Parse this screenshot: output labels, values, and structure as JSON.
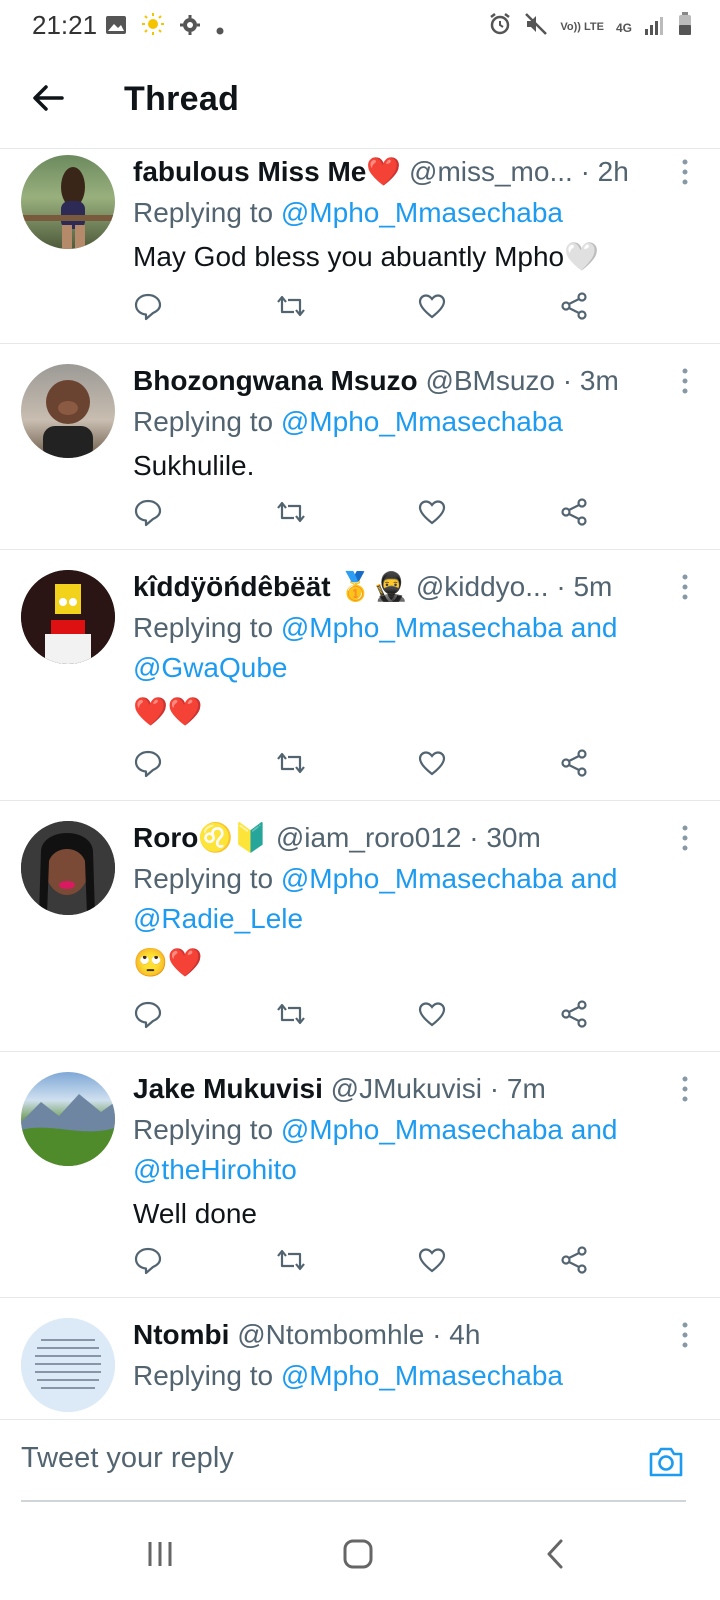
{
  "status_bar": {
    "time": "21:21",
    "left_icons": [
      "image-icon",
      "sun-icon",
      "settings-gear-icon",
      "dot-icon"
    ],
    "right_icons": [
      "alarm-icon",
      "mute-icon",
      "volte-icon",
      "4g-icon",
      "signal-icon",
      "battery-icon"
    ],
    "volte_text": "Vo)) LTE",
    "network_text": "4G"
  },
  "app_bar": {
    "title": "Thread"
  },
  "tweets": [
    {
      "name": "fabulous Miss Me❤️",
      "handle": "@miss_mo...",
      "time": "· 2h",
      "replying_prefix": "Replying to ",
      "replying_to": "@Mpho_Mmasechaba",
      "text": "May God bless you abuantly Mpho🤍"
    },
    {
      "name": "Bhozongwana Msuzo",
      "handle": "@BMsuzo",
      "time": "· 3m",
      "replying_prefix": "Replying to ",
      "replying_to": "@Mpho_Mmasechaba",
      "text": "Sukhulile."
    },
    {
      "name": "kîddÿöńdêbëät 🥇🥷",
      "handle": "@kiddyo...",
      "time": "· 5m",
      "replying_prefix": "Replying to ",
      "replying_to": "@Mpho_Mmasechaba and @GwaQube",
      "text": "❤️❤️"
    },
    {
      "name": "Roro♌🔰",
      "handle": "@iam_roro012",
      "time": "· 30m",
      "replying_prefix": "Replying to ",
      "replying_to": "@Mpho_Mmasechaba and @Radie_Lele",
      "text": "🙄❤️"
    },
    {
      "name": "Jake Mukuvisi",
      "handle": "@JMukuvisi",
      "time": "· 7m",
      "replying_prefix": "Replying to ",
      "replying_to": "@Mpho_Mmasechaba and @theHirohito",
      "text": "Well done"
    },
    {
      "name": "Ntombi",
      "handle": "@Ntombomhle",
      "time": "· 4h",
      "replying_prefix": "Replying to ",
      "replying_to": "@Mpho_Mmasechaba",
      "text": ""
    }
  ],
  "reply_bar": {
    "placeholder": "Tweet your reply"
  },
  "nav_bar": {
    "icons": [
      "recent-apps-icon",
      "home-icon",
      "back-icon"
    ]
  },
  "colors": {
    "link": "#1d9bf0",
    "secondary_text": "#536471",
    "heart_red": "#e0245e",
    "divider": "#e6e9eb"
  }
}
